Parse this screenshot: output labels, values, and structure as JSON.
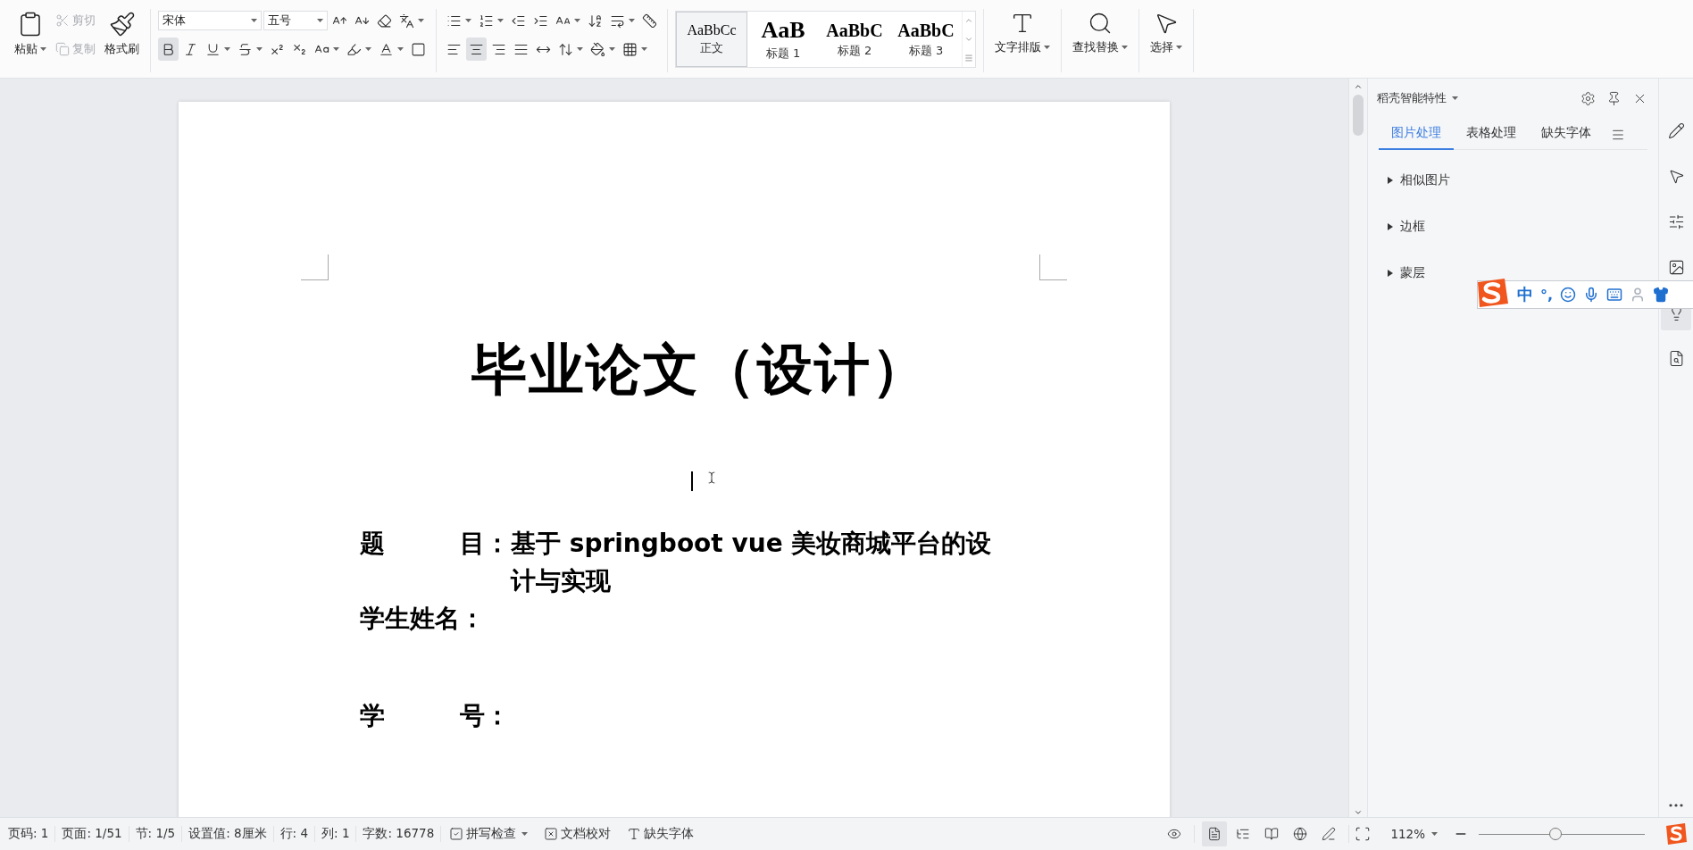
{
  "toolbar": {
    "clipboard": {
      "paste": {
        "label": "粘贴",
        "dropdown": true
      },
      "small": [
        {
          "kind": "cut",
          "label": "剪切",
          "disabled": true
        },
        {
          "kind": "copy",
          "label": "复制",
          "disabled": true
        }
      ],
      "painter": {
        "label": "格式刷"
      }
    },
    "font": {
      "family": "宋体",
      "size": "五号"
    },
    "font_row_1": [
      {
        "kind": "grow",
        "dropdown": false,
        "selected": false
      },
      {
        "kind": "shrink",
        "dropdown": false,
        "selected": false
      },
      {
        "kind": "clear",
        "dropdown": false,
        "selected": false
      },
      {
        "kind": "pinyin",
        "dropdown": true,
        "selected": false
      }
    ],
    "font_row_2": [
      {
        "kind": "bold",
        "dropdown": false,
        "selected": true
      },
      {
        "kind": "italic",
        "dropdown": false,
        "selected": false
      },
      {
        "kind": "underline",
        "dropdown": true,
        "selected": false
      },
      {
        "kind": "strike",
        "dropdown": true,
        "selected": false
      },
      {
        "kind": "superscript",
        "dropdown": false,
        "selected": false
      },
      {
        "kind": "subscript",
        "dropdown": false,
        "selected": false
      },
      {
        "kind": "effect",
        "dropdown": true,
        "selected": false
      },
      {
        "kind": "highlight",
        "dropdown": true,
        "selected": false
      },
      {
        "kind": "color",
        "dropdown": true,
        "selected": false
      },
      {
        "kind": "border",
        "dropdown": false,
        "selected": false
      }
    ],
    "para_row_1": [
      {
        "kind": "bullets",
        "dropdown": true,
        "selected": false
      },
      {
        "kind": "numbers",
        "dropdown": true,
        "selected": false
      },
      {
        "kind": "outdent",
        "dropdown": false,
        "selected": false
      },
      {
        "kind": "indent",
        "dropdown": false,
        "selected": false
      },
      {
        "kind": "case",
        "dropdown": true,
        "selected": false
      },
      {
        "kind": "sort",
        "dropdown": false,
        "selected": false
      },
      {
        "kind": "wrap",
        "dropdown": true,
        "selected": false
      },
      {
        "kind": "ruler",
        "dropdown": false,
        "selected": false
      }
    ],
    "para_row_2": [
      {
        "kind": "left",
        "dropdown": false,
        "selected": false
      },
      {
        "kind": "center",
        "dropdown": false,
        "selected": true
      },
      {
        "kind": "right",
        "dropdown": false,
        "selected": false
      },
      {
        "kind": "justify",
        "dropdown": false,
        "selected": false
      },
      {
        "kind": "distribute",
        "dropdown": false,
        "selected": false
      },
      {
        "kind": "spacing",
        "dropdown": true,
        "selected": false
      },
      {
        "kind": "shading",
        "dropdown": true,
        "selected": false
      },
      {
        "kind": "borders",
        "dropdown": true,
        "selected": false
      }
    ],
    "styles": [
      {
        "kind": "body",
        "sample": "AaBbCc",
        "label": "正文",
        "selected": true
      },
      {
        "kind": "h1",
        "sample": "AaB",
        "label": "标题 1",
        "selected": false
      },
      {
        "kind": "h2",
        "sample": "AaBbC",
        "label": "标题 2",
        "selected": false
      },
      {
        "kind": "h3",
        "sample": "AaBbC",
        "label": "标题 3",
        "selected": false
      }
    ],
    "tools": [
      {
        "kind": "layout",
        "label": "文字排版"
      },
      {
        "kind": "find",
        "label": "查找替换"
      },
      {
        "kind": "select",
        "label": "选择"
      }
    ]
  },
  "document": {
    "title": "毕业论文（设计）",
    "fields": [
      {
        "label": "题　　　目：",
        "value": "基于 springboot vue 美妆商城平台的设计与实现"
      },
      {
        "label": "学生姓名："
      },
      {
        "label": "学　　　号："
      }
    ]
  },
  "side_panel": {
    "title": "稻壳智能特性",
    "tabs": [
      {
        "label": "图片处理",
        "selected": true
      },
      {
        "label": "表格处理",
        "selected": false
      },
      {
        "label": "缺失字体",
        "selected": false
      }
    ],
    "sections": [
      {
        "label": "相似图片",
        "expanded": false
      },
      {
        "label": "边框",
        "expanded": false
      },
      {
        "label": "蒙层",
        "expanded": false
      }
    ]
  },
  "side_strip": [
    {
      "kind": "pen",
      "selected": false
    },
    {
      "kind": "pointer",
      "selected": false
    },
    {
      "kind": "sliders",
      "selected": false
    },
    {
      "kind": "image",
      "selected": false
    },
    {
      "kind": "bulb",
      "selected": true
    },
    {
      "kind": "book",
      "selected": false
    }
  ],
  "ime_bar": {
    "mode": "中",
    "punct": "°,"
  },
  "status_bar": {
    "items": [
      "页码: 1",
      "页面: 1/51",
      "节: 1/5",
      "设置值: 8厘米",
      "行: 4",
      "列: 1",
      "字数: 16778"
    ],
    "buttons": [
      {
        "kind": "spell",
        "label": "拼写检查",
        "dropdown": true
      },
      {
        "kind": "proof",
        "label": "文档校对",
        "dropdown": false
      },
      {
        "kind": "font",
        "label": "缺失字体",
        "dropdown": false
      }
    ],
    "views": [
      {
        "kind": "read",
        "selected": false
      },
      {
        "kind": "page",
        "selected": true
      },
      {
        "kind": "outline",
        "selected": false
      },
      {
        "kind": "book",
        "selected": false
      },
      {
        "kind": "web",
        "selected": false
      },
      {
        "kind": "write",
        "selected": false
      }
    ],
    "zoom": "112%",
    "zoom_level": {
      "level": 0.46
    }
  }
}
